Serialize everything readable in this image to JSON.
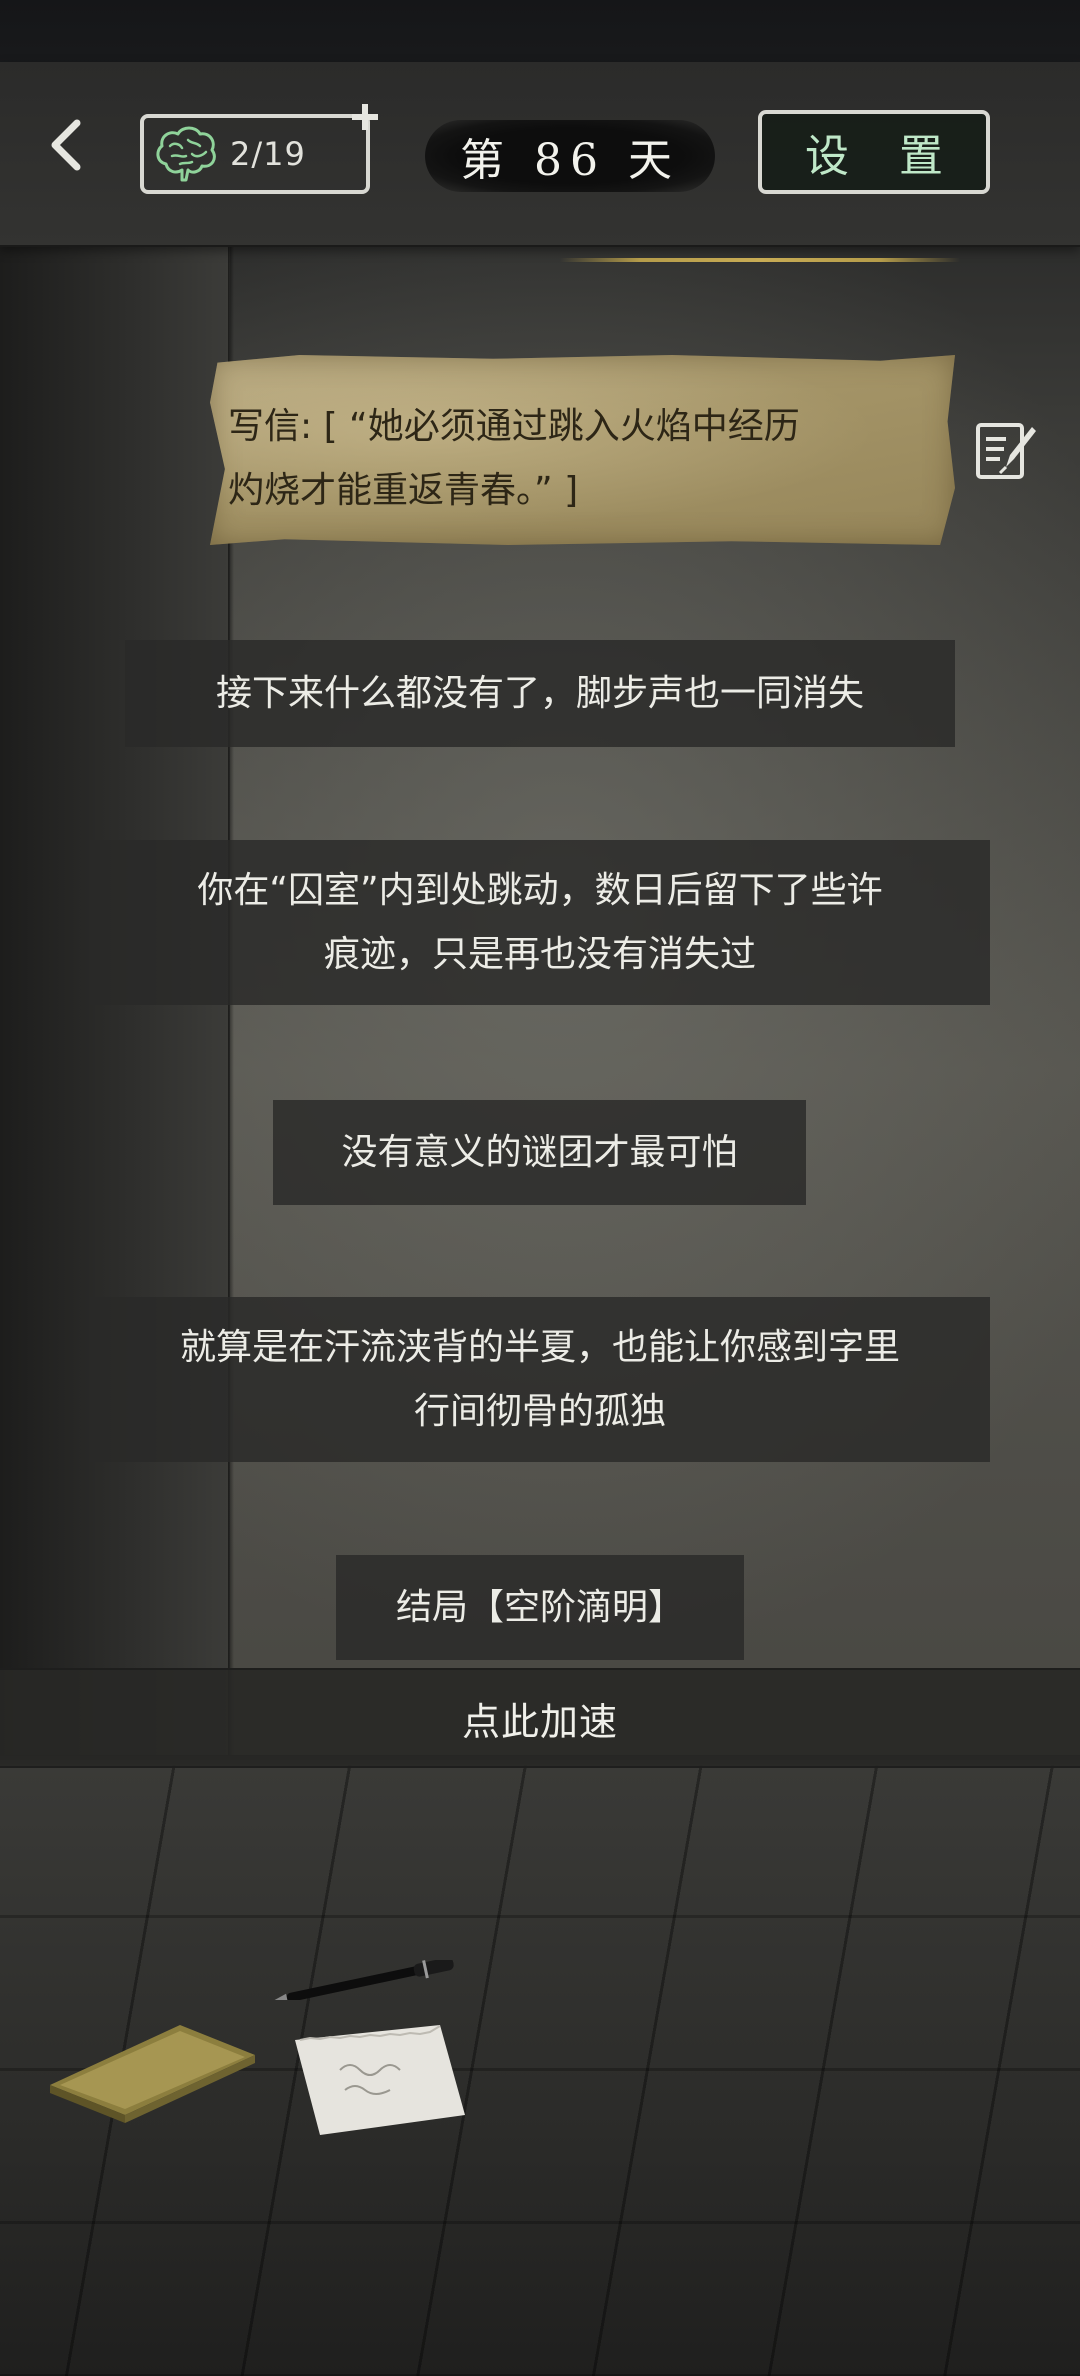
{
  "header": {
    "brain_count": "2/19",
    "day_label": "第 86 天",
    "settings_label": "设 置"
  },
  "letter": {
    "text_line1": "写信: [ “她必须通过跳入火焰中经历",
    "text_line2": "灼烧才能重返青春。” ]"
  },
  "messages": [
    {
      "line1": "接下来什么都没有了，脚步声也一同消失",
      "line2": ""
    },
    {
      "line1": "你在“囚室”内到处跳动，数日后留下了些许",
      "line2": "痕迹，只是再也没有消失过"
    },
    {
      "line1": "没有意义的谜团才最可怕",
      "line2": ""
    },
    {
      "line1": "就算是在汗流浃背的半夏，也能让你感到字里",
      "line2": "行间彻骨的孤独"
    },
    {
      "line1": "结局【空阶滴明】",
      "line2": ""
    }
  ],
  "speed_label": "点此加速",
  "colors": {
    "settings_text": "#bfe8c8",
    "brain_green": "#8fd39a",
    "letter_paper": "#a39366",
    "gold_line": "#c8ac55"
  },
  "icons": [
    "back-arrow-icon",
    "brain-icon",
    "plus-icon",
    "edit-note-icon"
  ]
}
